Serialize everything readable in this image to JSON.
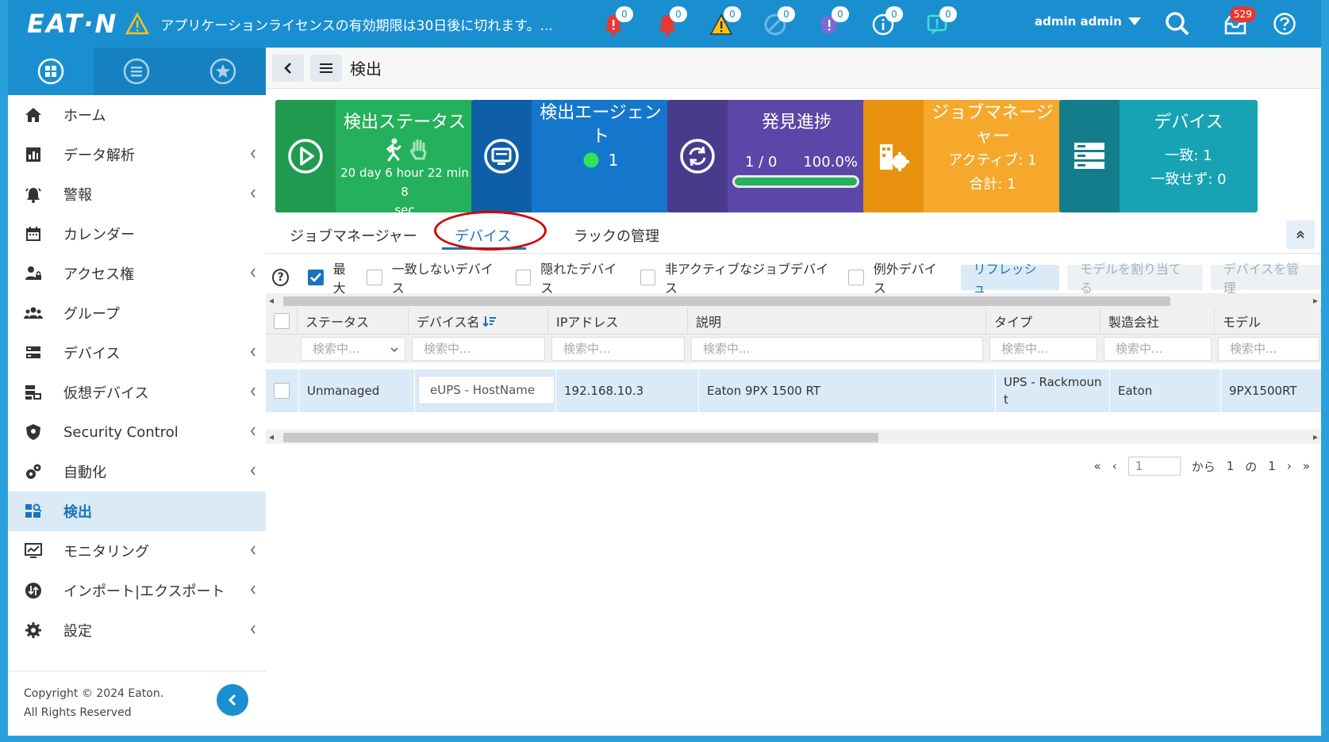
{
  "topbar": {
    "logo": "EAT·N",
    "license_warning": "アプリケーションライセンスの有効期限は30日後に切れます。...",
    "notifications": [
      {
        "icon": "bell-critical-icon",
        "count": "0"
      },
      {
        "icon": "bell-alarm-icon",
        "count": "0"
      },
      {
        "icon": "warning-icon",
        "count": "0"
      },
      {
        "icon": "disabled-icon",
        "count": "0"
      },
      {
        "icon": "shield-alert-icon",
        "count": "0"
      },
      {
        "icon": "info-icon",
        "count": "0"
      },
      {
        "icon": "message-alert-icon",
        "count": "0"
      }
    ],
    "user": "admin admin",
    "inbox_count": "529"
  },
  "sidebar": {
    "items": [
      {
        "label": "ホーム",
        "icon": "home-icon",
        "chevron": false
      },
      {
        "label": "データ解析",
        "icon": "chart-icon",
        "chevron": true
      },
      {
        "label": "警報",
        "icon": "alarm-icon",
        "chevron": true
      },
      {
        "label": "カレンダー",
        "icon": "calendar-icon",
        "chevron": false
      },
      {
        "label": "アクセス権",
        "icon": "user-lock-icon",
        "chevron": true
      },
      {
        "label": "グループ",
        "icon": "group-icon",
        "chevron": false
      },
      {
        "label": "デバイス",
        "icon": "server-icon",
        "chevron": true
      },
      {
        "label": "仮想デバイス",
        "icon": "virtual-device-icon",
        "chevron": true
      },
      {
        "label": "Security Control",
        "icon": "shield-icon",
        "chevron": true
      },
      {
        "label": "自動化",
        "icon": "gears-icon",
        "chevron": true
      },
      {
        "label": "検出",
        "icon": "discovery-icon",
        "chevron": false
      },
      {
        "label": "モニタリング",
        "icon": "monitor-icon",
        "chevron": true
      },
      {
        "label": "インポート|エクスポート",
        "icon": "import-export-icon",
        "chevron": true
      },
      {
        "label": "設定",
        "icon": "settings-icon",
        "chevron": true
      }
    ],
    "active_index": 10,
    "footer_line1": "Copyright © 2024 Eaton.",
    "footer_line2": "All Rights Reserved"
  },
  "header": {
    "title": "検出"
  },
  "cards": {
    "status": {
      "title": "検出ステータス",
      "time": "20 day 6 hour 22 min 8",
      "time2": "sec",
      "colors": {
        "side": "#1f9a4f",
        "body": "#25b15c"
      }
    },
    "agent": {
      "title1": "検出エージェン",
      "title2": "ト",
      "count": "1",
      "colors": {
        "side": "#0f5fa8",
        "body": "#1577cc"
      }
    },
    "progress": {
      "title": "発見進捗",
      "ratio": "1 / 0",
      "percent": "100.0%",
      "fill_fraction": 1.0,
      "colors": {
        "side": "#4a3a8c",
        "body": "#5b47a8"
      }
    },
    "jobs": {
      "title1": "ジョブマネージ",
      "title2": "ャー",
      "active": "アクティブ: 1",
      "total": "合計: 1",
      "colors": {
        "side": "#e8920f",
        "body": "#f5a82b"
      }
    },
    "devices": {
      "title": "デバイス",
      "match": "一致: 1",
      "nomatch": "一致せず: 0",
      "colors": {
        "side": "#137d8c",
        "body": "#17a3b4"
      }
    }
  },
  "tabs": [
    "ジョブマネージャー",
    "デバイス",
    "ラックの管理"
  ],
  "active_tab": 1,
  "toolbar": {
    "max_label": "最大",
    "unmatched_label": "一致しないデバイス",
    "hidden_label": "隠れたデバイス",
    "inactive_label": "非アクティブなジョブデバイス",
    "exception_label": "例外デバイス",
    "refresh": "リフレッシュ",
    "assign_model": "モデルを割り当てる",
    "manage_devices": "デバイスを管理"
  },
  "grid": {
    "columns": [
      "ステータス",
      "デバイス名",
      "IPアドレス",
      "説明",
      "タイプ",
      "製造会社",
      "モデル"
    ],
    "filter_placeholder": "検索中...",
    "rows": [
      {
        "status": "Unmanaged",
        "name": "eUPS - HostName",
        "ip": "192.168.10.3",
        "desc": "Eaton 9PX 1500 RT",
        "type1": "UPS - Rackmoun",
        "type2": "t",
        "maker": "Eaton",
        "model": "9PX1500RT"
      }
    ]
  },
  "pager": {
    "page": "1",
    "from_label": "から",
    "current": "1",
    "of_label": "の",
    "total": "1"
  }
}
